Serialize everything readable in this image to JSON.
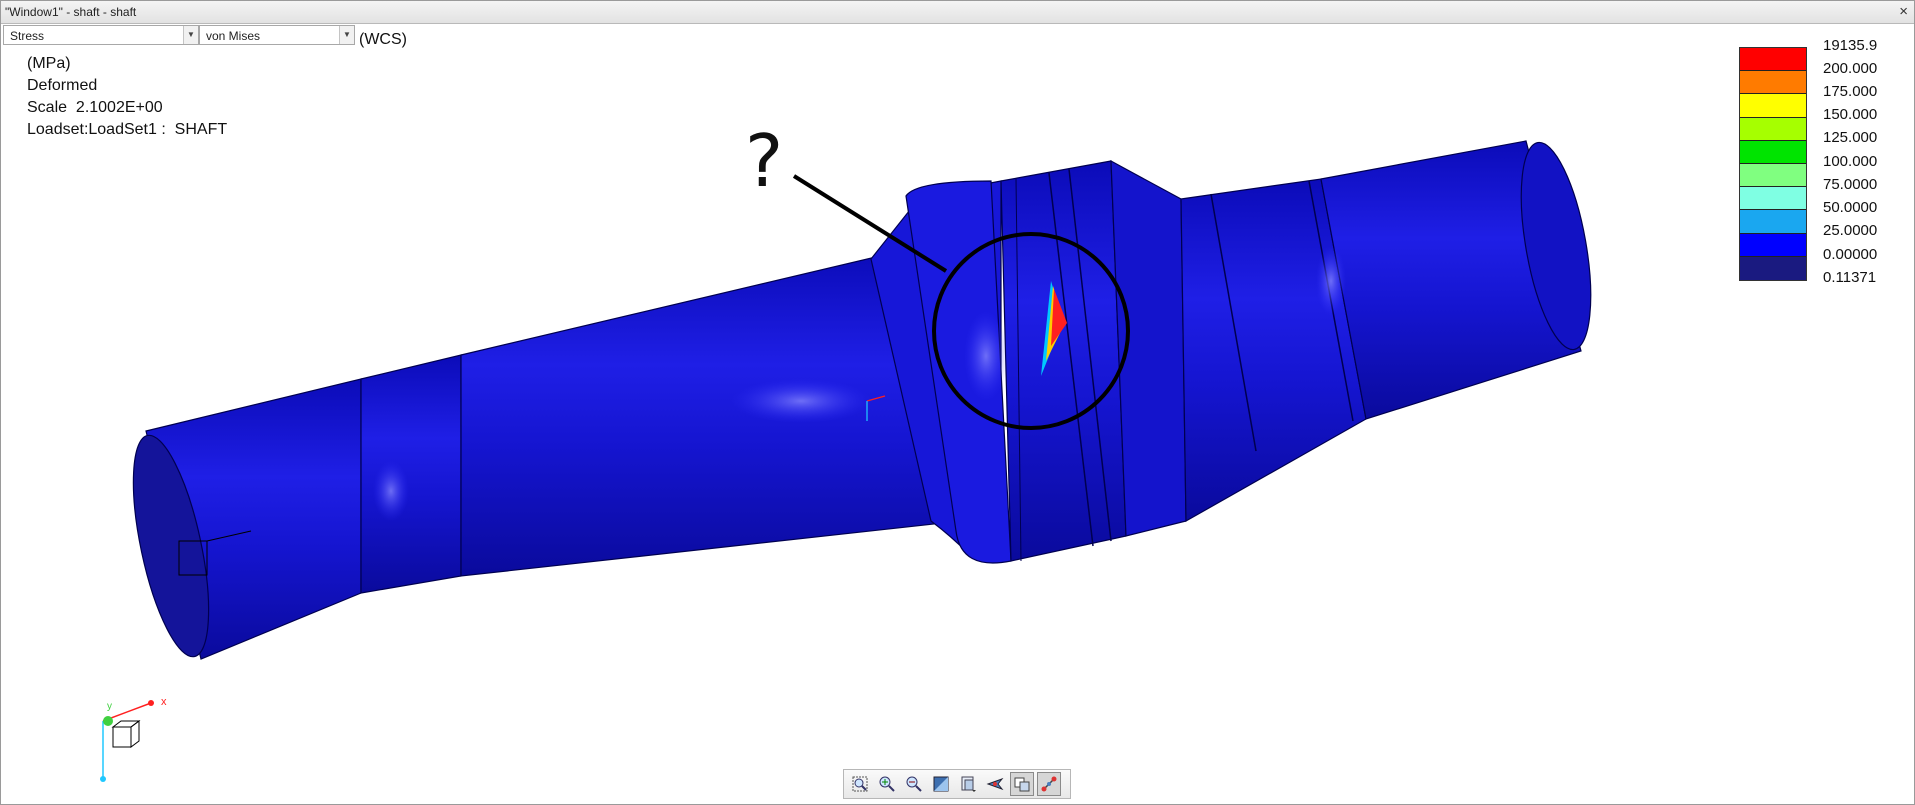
{
  "window": {
    "title": "\"Window1\" - shaft - shaft",
    "close_label": "×"
  },
  "selectors": {
    "quantity": {
      "value": "Stress"
    },
    "component": {
      "value": "von Mises"
    },
    "csys_label": "(WCS)"
  },
  "info": {
    "units": "(MPa)",
    "mode": "Deformed",
    "scale": "Scale  2.1002E+00",
    "loadset": "Loadset:LoadSet1 :  SHAFT"
  },
  "annotation": {
    "question_mark": "?"
  },
  "legend": {
    "colors": [
      "#ff0000",
      "#ff7b00",
      "#ffff00",
      "#a6ff00",
      "#00e400",
      "#80ff80",
      "#7fffe3",
      "#1aa7f0",
      "#0000ff",
      "#1a1a80"
    ],
    "labels": [
      "19135.9",
      "200.000",
      "175.000",
      "150.000",
      "125.000",
      "100.000",
      "75.0000",
      "50.0000",
      "25.0000",
      "0.00000",
      "0.11371"
    ]
  },
  "triad": {
    "x_label": "x",
    "y_label": "y"
  },
  "toolbar": {
    "buttons": [
      {
        "name": "zoom-window-icon",
        "active": false
      },
      {
        "name": "zoom-in-icon",
        "active": false
      },
      {
        "name": "zoom-out-icon",
        "active": false
      },
      {
        "name": "shading-icon",
        "active": false
      },
      {
        "name": "saved-views-icon",
        "active": false
      },
      {
        "name": "spin-center-icon",
        "active": false
      },
      {
        "name": "display-style-icon",
        "active": true
      },
      {
        "name": "datum-display-icon",
        "active": true
      }
    ]
  },
  "colors": {
    "model_blue": "#1a1ad9",
    "background": "#ffffff"
  }
}
